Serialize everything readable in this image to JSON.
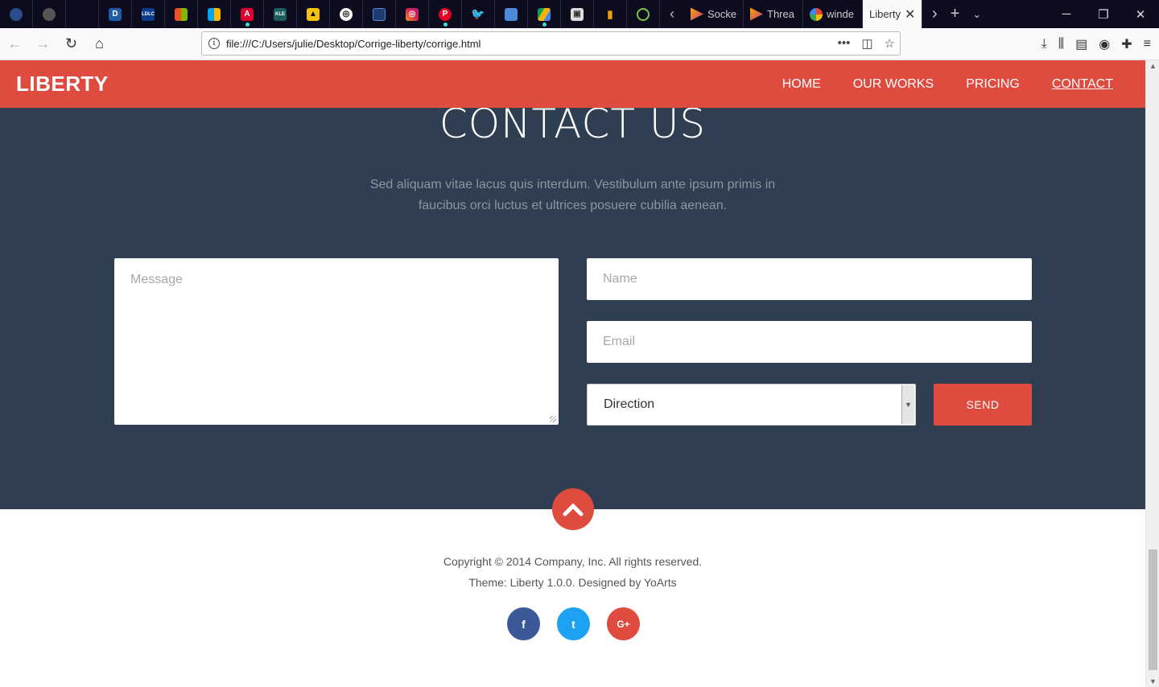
{
  "browser": {
    "tabs": [
      {
        "title": "Socke"
      },
      {
        "title": "Threa"
      },
      {
        "title": "winde"
      },
      {
        "title": "Liberty",
        "active": true
      }
    ],
    "url": "file:///C:/Users/julie/Desktop/Corrige-liberty/corrige.html",
    "pinned_icons": [
      "moon-icon",
      "circle-icon",
      "blank",
      "d-icon",
      "ldlc-icon",
      "windows-icon",
      "windows-icon",
      "angular-icon",
      "kle-icon",
      "yellow-icon",
      "globe-icon",
      "card-icon",
      "instagram-icon",
      "pinterest-icon",
      "twitter-icon",
      "map-icon",
      "drive-icon",
      "bag-icon",
      "chart-icon",
      "ring-icon"
    ]
  },
  "site": {
    "brand": "LIBERTY",
    "menu": [
      "HOME",
      "OUR WORKS",
      "PRICING",
      "CONTACT"
    ],
    "contact": {
      "title": "CONTACT US",
      "lead": "Sed aliquam vitae lacus quis interdum. Vestibulum ante ipsum primis in faucibus orci luctus et ultrices posuere cubilia aenean.",
      "message_placeholder": "Message",
      "name_placeholder": "Name",
      "email_placeholder": "Email",
      "direction_value": "Direction",
      "send_label": "SEND"
    },
    "footer": {
      "copyright": "Copyright © 2014 Company, Inc. All rights reserved.",
      "theme": "Theme: Liberty 1.0.0. Designed by YoArts",
      "socials": [
        {
          "name": "facebook-icon",
          "glyph": "f",
          "color": "#3b5998"
        },
        {
          "name": "twitter-icon",
          "glyph": "t",
          "color": "#1da1f2"
        },
        {
          "name": "google-plus-icon",
          "glyph": "G+",
          "color": "#e04b3f"
        }
      ]
    }
  },
  "colors": {
    "accent": "#e04b3f",
    "section_bg": "#2f3e51"
  }
}
